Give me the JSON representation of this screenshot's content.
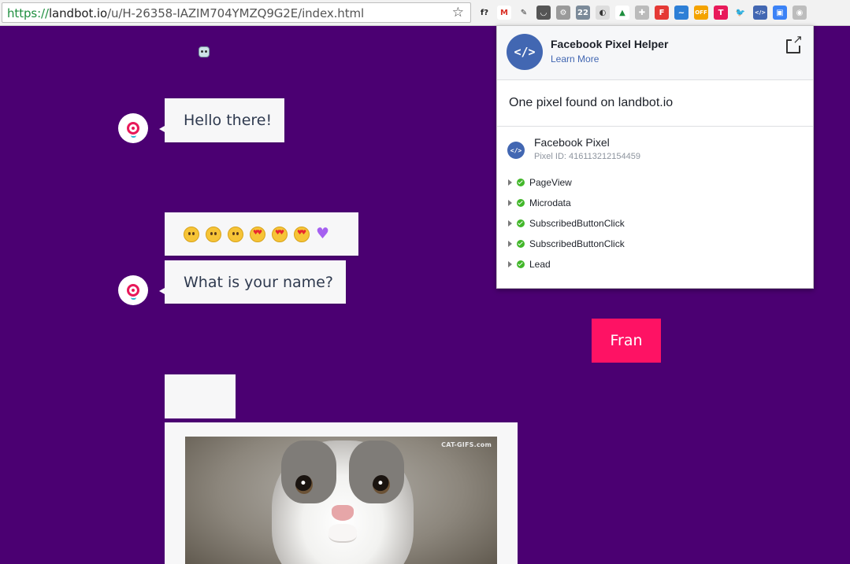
{
  "browser": {
    "url_scheme": "https://",
    "url_host": "landbot.io",
    "url_path": "/u/H-26358-IAZIM704YMZQ9G2E/index.html",
    "star_icon": "☆",
    "extensions": [
      {
        "name": "formula-ext-icon",
        "label": "f?",
        "bg": "#f2f2f2",
        "fg": "#222"
      },
      {
        "name": "gmail-icon",
        "label": "M",
        "bg": "#ffffff",
        "fg": "#d93025"
      },
      {
        "name": "eyedropper-icon",
        "label": "✎",
        "bg": "#f2f2f2",
        "fg": "#333"
      },
      {
        "name": "pocket-icon",
        "label": "◡",
        "bg": "#555555",
        "fg": "#fff"
      },
      {
        "name": "gear-ext-icon",
        "label": "⚙",
        "bg": "#9a9a9a",
        "fg": "#fff"
      },
      {
        "name": "calendar-icon",
        "label": "22",
        "bg": "#7b8a99",
        "fg": "#fff"
      },
      {
        "name": "chrome-icon",
        "label": "◐",
        "bg": "#dddddd",
        "fg": "#333"
      },
      {
        "name": "drive-icon",
        "label": "▲",
        "bg": "#ffffff",
        "fg": "#1e8e3e"
      },
      {
        "name": "puzzle-icon",
        "label": "✚",
        "bg": "#bbbbbb",
        "fg": "#fff"
      },
      {
        "name": "framer-icon",
        "label": "F",
        "bg": "#e53935",
        "fg": "#fff"
      },
      {
        "name": "chart-ext-icon",
        "label": "~",
        "bg": "#2d7fd6",
        "fg": "#fff"
      },
      {
        "name": "off-badge-icon",
        "label": "OFF",
        "bg": "#f4a300",
        "fg": "#fff"
      },
      {
        "name": "t-circle-icon",
        "label": "T",
        "bg": "#e8195a",
        "fg": "#fff"
      },
      {
        "name": "twitter-icon",
        "label": "🐦",
        "bg": "#f2f2f2",
        "fg": "#bbb"
      },
      {
        "name": "pixel-helper-icon",
        "label": "</>",
        "bg": "#4267b2",
        "fg": "#fff"
      },
      {
        "name": "window-ext-icon",
        "label": "▣",
        "bg": "#3b82f6",
        "fg": "#fff"
      },
      {
        "name": "camera-icon",
        "label": "◉",
        "bg": "#bdbdbd",
        "fg": "#fff"
      }
    ]
  },
  "chat": {
    "greeting": "Hello there!",
    "question": "What is your name?",
    "user_answer": "Fran",
    "image_watermark": "CAT-GIFS.com"
  },
  "popup": {
    "title": "Facebook Pixel Helper",
    "learn_more": "Learn More",
    "summary": "One pixel found on landbot.io",
    "pixel_name": "Facebook Pixel",
    "pixel_id": "Pixel ID: 416113212154459",
    "logo_glyph": "</>",
    "events": [
      "PageView",
      "Microdata",
      "SubscribedButtonClick",
      "SubscribedButtonClick",
      "Lead"
    ]
  },
  "colors": {
    "page_bg": "#4b0072",
    "accent_pink": "#fe1264",
    "facebook_blue": "#4267b2",
    "success_green": "#42b72a"
  }
}
